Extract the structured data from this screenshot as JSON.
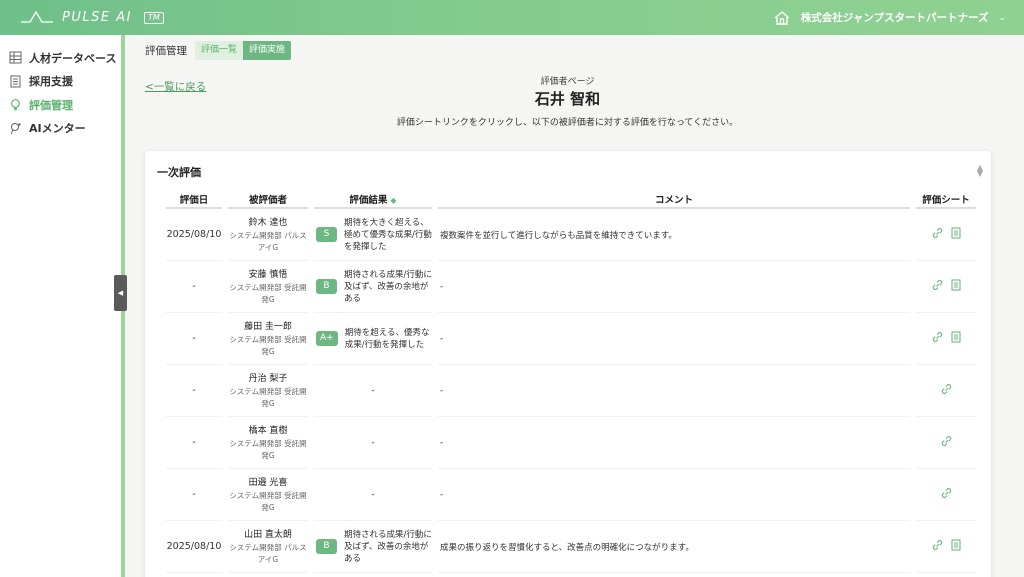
{
  "header": {
    "logo_text": "PULSE AI",
    "logo_badge": "TM",
    "company": "株式会社ジャンプスタートパートナーズ",
    "colors": {
      "accent": "#6db783",
      "header_start": "#6fbf8a",
      "header_end": "#8fd193"
    }
  },
  "sidebar": {
    "items": [
      {
        "label": "人材データベース",
        "icon": "database-icon",
        "active": false
      },
      {
        "label": "採用支援",
        "icon": "document-icon",
        "active": false
      },
      {
        "label": "評価管理",
        "icon": "bulb-icon",
        "active": true
      },
      {
        "label": "AIメンター",
        "icon": "mentor-icon",
        "active": false
      }
    ]
  },
  "breadcrumb": {
    "label": "評価管理",
    "tabs": [
      "評価一覧",
      "評価実施"
    ]
  },
  "page": {
    "back_link": "<一覧に戻る",
    "evaluator_label": "評価者ページ",
    "evaluator_name": "石井 智和",
    "instruction": "評価シートリンクをクリックし、以下の被評価者に対する評価を行なってください。"
  },
  "card": {
    "title": "一次評価",
    "columns": [
      "評価日",
      "被評価者",
      "評価結果",
      "コメント",
      "評価シート"
    ],
    "rows": [
      {
        "date": "2025/08/10",
        "name": "鈴木 達也",
        "dept": "システム開発部 パルスアイG",
        "grade": "S",
        "result": "期待を大きく超える、極めて優秀な成果/行動を発揮した",
        "comment": "複数案件を並行して進行しながらも品質を維持できています。",
        "doc": true
      },
      {
        "date": "-",
        "name": "安藤 慎悟",
        "dept": "システム開発部 受託開発G",
        "grade": "B",
        "result": "期待される成果/行動に及ばず、改善の余地がある",
        "comment": "-",
        "doc": true
      },
      {
        "date": "-",
        "name": "藤田 圭一郎",
        "dept": "システム開発部 受託開発G",
        "grade": "A+",
        "result": "期待を超える、優秀な成果/行動を発揮した",
        "comment": "-",
        "doc": true
      },
      {
        "date": "-",
        "name": "丹治 梨子",
        "dept": "システム開発部 受託開発G",
        "grade": "",
        "result": "-",
        "comment": "-",
        "doc": false
      },
      {
        "date": "-",
        "name": "橋本 直樹",
        "dept": "システム開発部 受託開発G",
        "grade": "",
        "result": "-",
        "comment": "-",
        "doc": false
      },
      {
        "date": "-",
        "name": "田邉 光喜",
        "dept": "システム開発部 受託開発G",
        "grade": "",
        "result": "-",
        "comment": "-",
        "doc": false
      },
      {
        "date": "2025/08/10",
        "name": "山田 直太朗",
        "dept": "システム開発部 パルスアイG",
        "grade": "B",
        "result": "期待される成果/行動に及ばず、改善の余地がある",
        "comment": "成果の振り返りを習慣化すると、改善点の明確化につながります。",
        "doc": true
      }
    ]
  }
}
